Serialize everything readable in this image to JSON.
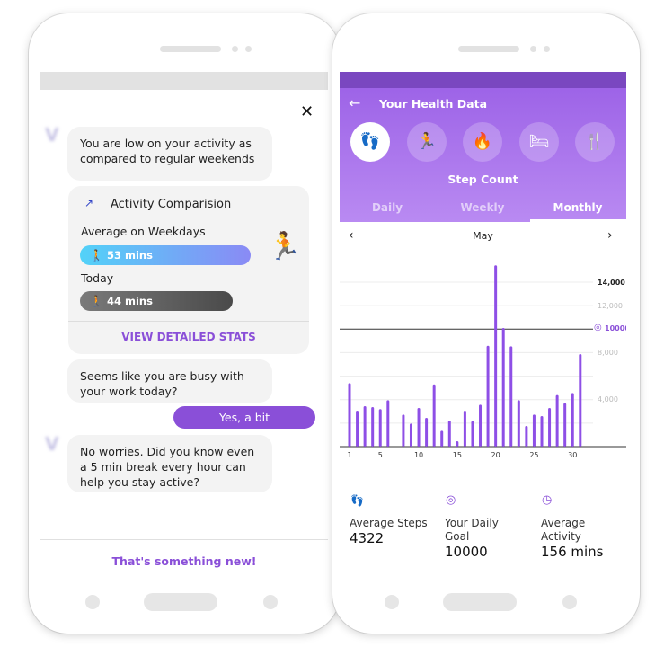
{
  "chat": {
    "msg1": "You are low on your activity as compared to regular weekends",
    "card": {
      "title": "Activity Comparision",
      "weekday_label": "Average on Weekdays",
      "weekday_value": "53 mins",
      "today_label": "Today",
      "today_value": "44 mins",
      "action": "VIEW DETAILED STATS"
    },
    "msg2": "Seems like you are busy with your work today?",
    "reply": "Yes, a bit",
    "msg3": "No worries. Did you know even a 5 min break every hour can help you stay active?",
    "footer_action": "That's something new!",
    "accent": "#8a4fd8"
  },
  "health": {
    "title": "Your Health Data",
    "categories": [
      "steps-icon",
      "running-icon",
      "flame-icon",
      "sleep-icon",
      "food-icon"
    ],
    "selected_category": "Step Count",
    "tabs": [
      "Daily",
      "Weekly",
      "Monthly"
    ],
    "active_tab": "Monthly",
    "month": "May",
    "header_color": "#a56ce8",
    "stats": [
      {
        "label": "Average Steps",
        "value": "4322",
        "icon": "footsteps-icon"
      },
      {
        "label": "Your Daily Goal",
        "value": "10000",
        "icon": "target-icon"
      },
      {
        "label": "Average Activity",
        "value": "156 mins",
        "icon": "clock-icon"
      }
    ]
  },
  "chart_data": {
    "type": "bar",
    "x": [
      1,
      2,
      3,
      4,
      5,
      6,
      7,
      8,
      9,
      10,
      11,
      12,
      13,
      14,
      15,
      16,
      17,
      18,
      19,
      20,
      21,
      22,
      23,
      24,
      25,
      26,
      27,
      28,
      29,
      30,
      31
    ],
    "values": [
      5400,
      3060,
      3440,
      3370,
      3190,
      3950,
      0,
      2730,
      1960,
      3290,
      2450,
      5300,
      1350,
      2220,
      460,
      3060,
      2170,
      3570,
      8590,
      15430,
      10100,
      8540,
      3950,
      1760,
      2730,
      2600,
      3290,
      4390,
      3700,
      4560,
      7880
    ],
    "x_tick_labels": [
      "1",
      "5",
      "10",
      "15",
      "20",
      "25",
      "30"
    ],
    "y_tick_labels": [
      "14,000",
      "12,000",
      "8,000",
      "4,000"
    ],
    "goal": 10000,
    "goal_label": "10000",
    "ylim": [
      0,
      16000
    ],
    "grid": true,
    "bar_color": "#8e4fe6"
  }
}
